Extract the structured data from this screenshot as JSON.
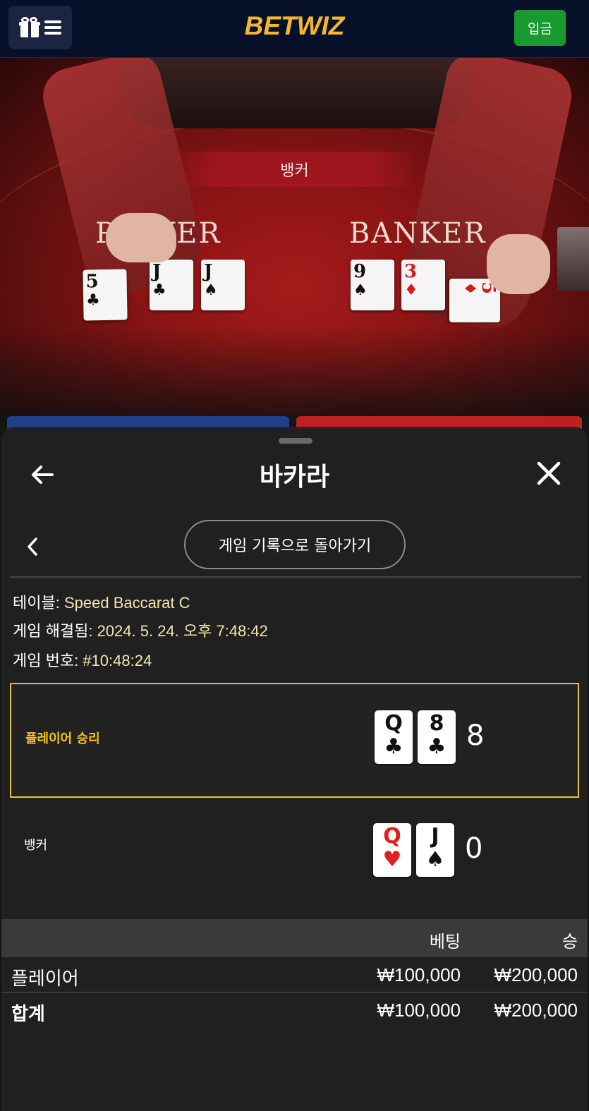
{
  "header": {
    "logo_text": "BETWIZ",
    "deposit_label": "입금",
    "icons": [
      "gift-icon",
      "menu-icon"
    ]
  },
  "video": {
    "result_banner": "뱅커",
    "table_labels": {
      "player": "PLAYER",
      "banker": "BANKER"
    },
    "player_cards": [
      {
        "rank": "5",
        "suit": "♣"
      },
      {
        "rank": "J",
        "suit": "♣"
      },
      {
        "rank": "J",
        "suit": "♠"
      }
    ],
    "banker_cards": [
      {
        "rank": "9",
        "suit": "♠"
      },
      {
        "rank": "3",
        "suit": "♦"
      },
      {
        "rank": "5",
        "suit": "♦"
      }
    ]
  },
  "modal": {
    "title": "바카라",
    "history_button": "게임 기록으로 돌아가기",
    "info": {
      "table_label": "테이블:",
      "table_value": "Speed Baccarat C",
      "resolved_label": "게임 해결됨:",
      "resolved_value": "2024. 5. 24. 오후 7:48:42",
      "number_label": "게임 번호:",
      "number_value": "#10:48:24"
    },
    "results": [
      {
        "label": "플레이어 승리",
        "winner": true,
        "cards": [
          {
            "rank": "Q",
            "suit": "♣",
            "color": "black"
          },
          {
            "rank": "8",
            "suit": "♣",
            "color": "black"
          }
        ],
        "score": "8"
      },
      {
        "label": "뱅커",
        "winner": false,
        "cards": [
          {
            "rank": "Q",
            "suit": "♥",
            "color": "red"
          },
          {
            "rank": "J",
            "suit": "♠",
            "color": "black"
          }
        ],
        "score": "0"
      }
    ],
    "bets": {
      "headers": {
        "bet": "베팅",
        "win": "승"
      },
      "rows": [
        {
          "label": "플레이어",
          "bet": "₩100,000",
          "win": "₩200,000"
        },
        {
          "label": "합계",
          "bet": "₩100,000",
          "win": "₩200,000"
        }
      ]
    }
  },
  "colors": {
    "header_bg": "#061029",
    "deposit_green": "#189a31",
    "logo_gold": "#f5b82a",
    "winner_border": "#e6c23a",
    "info_value": "#f2e6b2"
  }
}
